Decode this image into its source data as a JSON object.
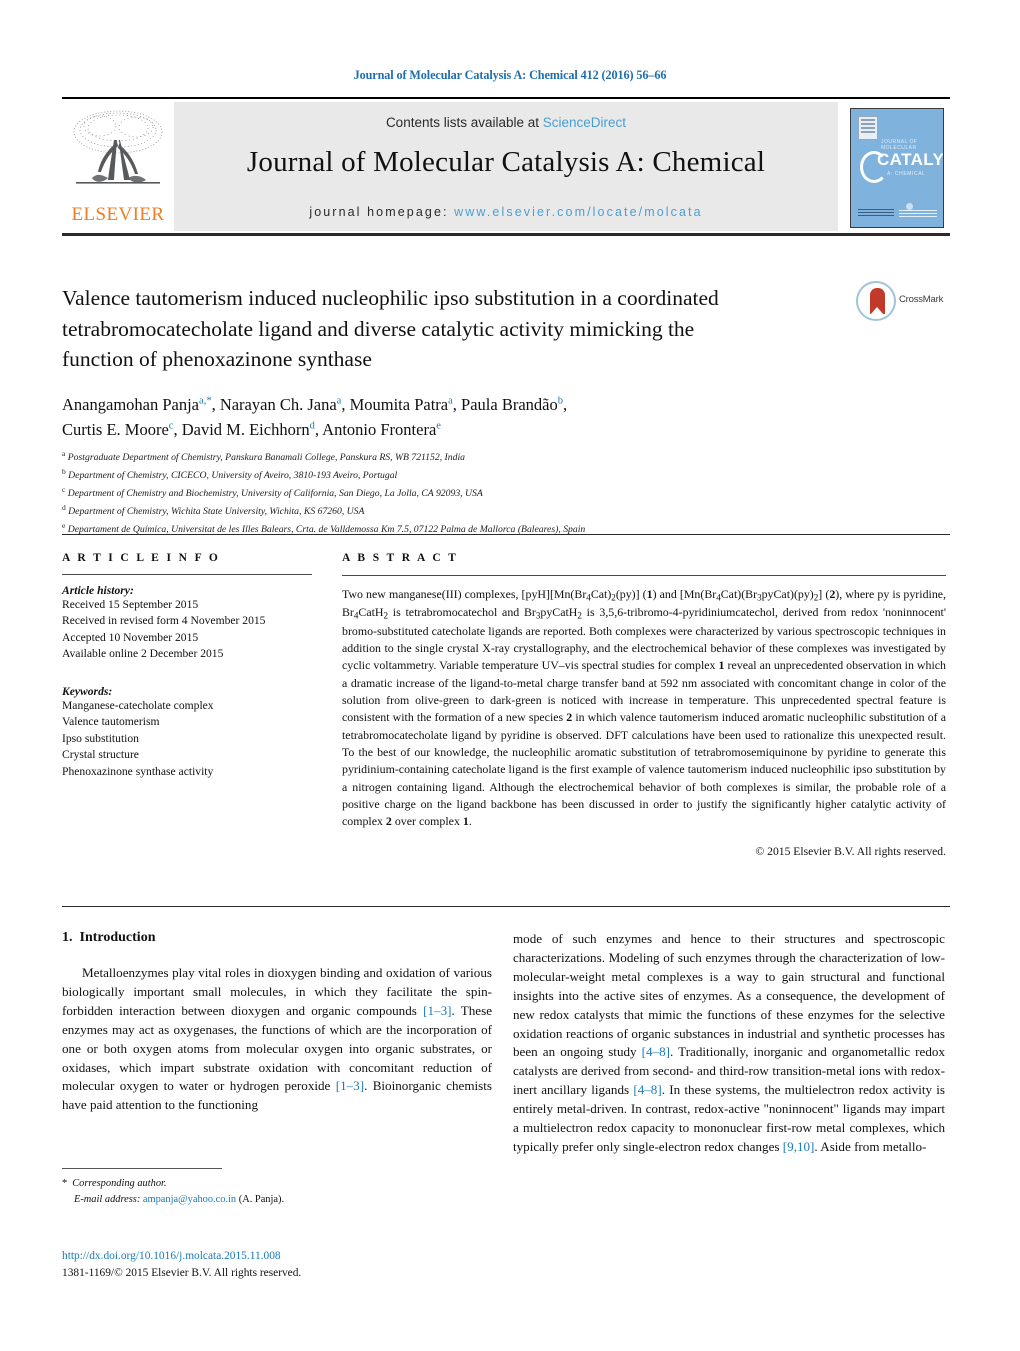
{
  "running_head": "Journal of Molecular Catalysis A: Chemical 412 (2016) 56–66",
  "masthead": {
    "publisher": "ELSEVIER",
    "contents_prefix": "Contents lists available at ",
    "contents_link": "ScienceDirect",
    "journal_title": "Journal of Molecular Catalysis A: Chemical",
    "homepage_prefix": "journal homepage: ",
    "homepage_url": "www.elsevier.com/locate/molcata",
    "cover": {
      "line_top": "JOURNAL OF MOLECULAR",
      "title": "CATALYSIS",
      "subtitle": "A: CHEMICAL"
    }
  },
  "article": {
    "title": "Valence tautomerism induced nucleophilic ipso substitution in a coordinated tetrabromocatecholate ligand and diverse catalytic activity mimicking the function of phenoxazinone synthase",
    "crossmark_label": "CrossMark",
    "authors_line1": "Anangamohan Panja",
    "authors": [
      {
        "name": "Anangamohan Panja",
        "sup": "a",
        "corresponding": true
      },
      {
        "name": "Narayan Ch. Jana",
        "sup": "a"
      },
      {
        "name": "Moumita Patra",
        "sup": "a"
      },
      {
        "name": "Paula Brandão",
        "sup": "b"
      },
      {
        "name": "Curtis E. Moore",
        "sup": "c"
      },
      {
        "name": "David M. Eichhorn",
        "sup": "d"
      },
      {
        "name": "Antonio Frontera",
        "sup": "e"
      }
    ],
    "affiliations": [
      {
        "mark": "a",
        "text": "Postgraduate Department of Chemistry, Panskura Banamali College, Panskura RS, WB 721152, India"
      },
      {
        "mark": "b",
        "text": "Department of Chemistry, CICECO, University of Aveiro, 3810-193 Aveiro, Portugal"
      },
      {
        "mark": "c",
        "text": "Department of Chemistry and Biochemistry, University of California, San Diego, La Jolla, CA 92093, USA"
      },
      {
        "mark": "d",
        "text": "Department of Chemistry, Wichita State University, Wichita, KS 67260, USA"
      },
      {
        "mark": "e",
        "text": "Departament de Química, Universitat de les Illes Balears, Crta. de Valldemossa Km 7.5, 07122 Palma de Mallorca (Baleares), Spain"
      }
    ]
  },
  "article_info": {
    "heading": "A R T I C L E   I N F O",
    "history_label": "Article history:",
    "history": [
      "Received 15 September 2015",
      "Received in revised form 4 November 2015",
      "Accepted 10 November 2015",
      "Available online 2 December 2015"
    ],
    "keywords_label": "Keywords:",
    "keywords": [
      "Manganese-catecholate complex",
      "Valence tautomerism",
      "Ipso substitution",
      "Crystal structure",
      "Phenoxazinone synthase activity"
    ]
  },
  "abstract": {
    "heading": "A B S T R A C T",
    "copyright": "© 2015 Elsevier B.V. All rights reserved."
  },
  "introduction": {
    "heading_number": "1.",
    "heading_title": "Introduction"
  },
  "footnote": {
    "star": "*",
    "corresponding_author": "Corresponding author.",
    "email_label": "E-mail address:",
    "email": "ampanja@yahoo.co.in",
    "email_suffix": "(A. Panja)."
  },
  "footer": {
    "doi": "http://dx.doi.org/10.1016/j.molcata.2015.11.008",
    "issn_line": "1381-1169/© 2015 Elsevier B.V. All rights reserved."
  },
  "colors": {
    "link": "#1a7bb5",
    "header_blue": "#1f6fae",
    "elsevier_orange": "#ef7d22",
    "band_gray": "#e9e9e9",
    "cover_blue": "#7fb2dd"
  }
}
